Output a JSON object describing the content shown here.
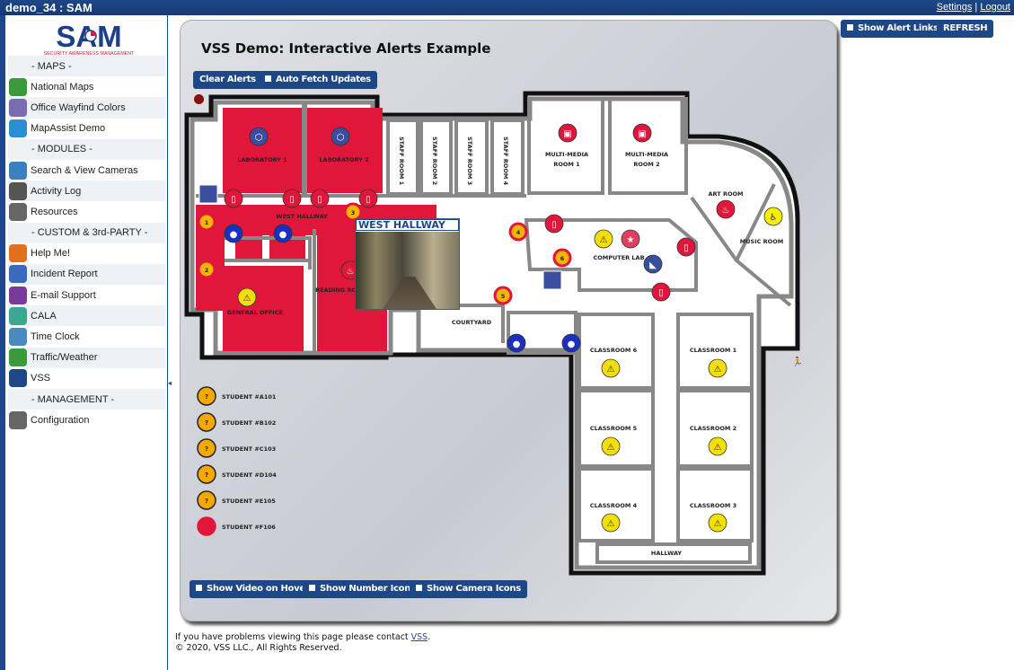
{
  "window": {
    "title": "demo_34 :   SAM",
    "settings": "Settings",
    "sep": "|",
    "logout": "Logout"
  },
  "logo": {
    "text": "SAM",
    "tagline": "SECURITY AWARENESS MANAGEMENT"
  },
  "sidebar": {
    "items": [
      {
        "label": "- MAPS -",
        "type": "header"
      },
      {
        "label": "National Maps",
        "icon": "us-map-icon",
        "color": "#3a9a3a"
      },
      {
        "label": "Office Wayfind Colors",
        "icon": "wayfind-icon",
        "color": "#7b6bb0"
      },
      {
        "label": "MapAssist Demo",
        "icon": "compass-icon",
        "color": "#2a8fd0"
      },
      {
        "label": "- MODULES -",
        "type": "header"
      },
      {
        "label": "Search & View Cameras",
        "icon": "camera-icon",
        "color": "#3a7fc0"
      },
      {
        "label": "Activity Log",
        "icon": "log-icon",
        "color": "#555"
      },
      {
        "label": "Resources",
        "icon": "tools-icon",
        "color": "#666"
      },
      {
        "label": "- CUSTOM & 3rd-PARTY -",
        "type": "header"
      },
      {
        "label": "Help Me!",
        "icon": "alert-icon",
        "color": "#e0701e"
      },
      {
        "label": "Incident Report",
        "icon": "report-icon",
        "color": "#3a6ac0"
      },
      {
        "label": "E-mail Support",
        "icon": "email-icon",
        "color": "#7a3a9a"
      },
      {
        "label": "CALA",
        "icon": "caduceus-icon",
        "color": "#3aa890"
      },
      {
        "label": "Time Clock",
        "icon": "clock-icon",
        "color": "#4a8ac0"
      },
      {
        "label": "Traffic/Weather",
        "icon": "us-map-icon",
        "color": "#3a9a3a"
      },
      {
        "label": "VSS",
        "icon": "vss-icon",
        "color": "#1d4787"
      },
      {
        "label": "- MANAGEMENT -",
        "type": "header"
      },
      {
        "label": "Configuration",
        "icon": "tools-icon",
        "color": "#666"
      }
    ]
  },
  "main": {
    "title": "VSS Demo: Interactive Alerts Example",
    "clear_alerts": "Clear Alerts",
    "auto_fetch": "Auto Fetch Updates",
    "show_alert_links": "Show Alert Links",
    "refresh": "REFRESH",
    "show_video": "Show Video on Hover",
    "show_numbers": "Show Number Icons",
    "show_cameras": "Show Camera Icons"
  },
  "floorplan": {
    "alert_color": "#e0163a",
    "rooms": {
      "lab1": "LABORATORY 1",
      "lab2": "LABORATORY 2",
      "west_hallway": "WEST HALLWAY",
      "general_office": "GENERAL OFFICE",
      "reading_room": "READING ROOM",
      "staff1": "STAFF ROOM 1",
      "staff2": "STAFF ROOM 2",
      "staff3": "STAFF ROOM 3",
      "staff4": "STAFF ROOM 4",
      "mm1a": "MULTI-MEDIA",
      "mm1b": "ROOM 1",
      "mm2a": "MULTI-MEDIA",
      "mm2b": "ROOM 2",
      "art": "ART ROOM",
      "music": "MUSIC ROOM",
      "computer_lab": "COMPUTER LAB",
      "courtyard": "COURTYARD",
      "c6": "CLASSROOM 6",
      "c1": "CLASSROOM 1",
      "c5": "CLASSROOM 5",
      "c2": "CLASSROOM 2",
      "c4": "CLASSROOM 4",
      "c3": "CLASSROOM 3",
      "hallway": "HALLWAY"
    },
    "cameras": [
      "1",
      "2",
      "3",
      "4",
      "5",
      "6"
    ]
  },
  "video": {
    "title": "WEST HALLWAY"
  },
  "students": [
    {
      "label": "STUDENT #A101",
      "status": "unknown"
    },
    {
      "label": "STUDENT #B102",
      "status": "unknown"
    },
    {
      "label": "STUDENT #C103",
      "status": "unknown"
    },
    {
      "label": "STUDENT #D104",
      "status": "unknown"
    },
    {
      "label": "STUDENT #E105",
      "status": "unknown"
    },
    {
      "label": "STUDENT #F106",
      "status": "alert"
    }
  ],
  "footer": {
    "line1": "If you have problems viewing this page please contact ",
    "link": "VSS",
    "dot": ".",
    "line2": "© 2020, VSS LLC., All Rights Reserved."
  }
}
